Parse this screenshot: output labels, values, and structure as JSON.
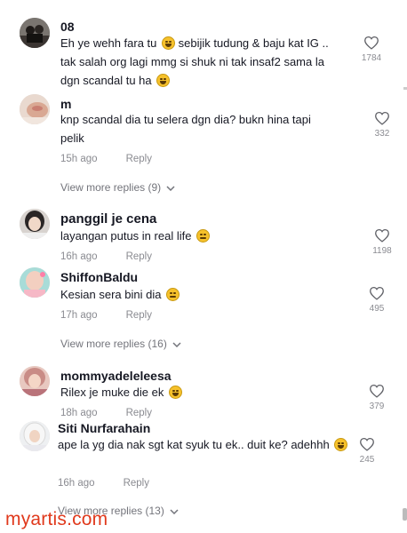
{
  "comments": [
    {
      "username": "08",
      "text": "Eh ye wehh fara tu",
      "text_after_emoji": "sebijik tudung & baju kat IG .. tak salah org lagi mmg si shuk ni tak insaf2 sama la dgn scandal tu ha",
      "likes": "1784"
    },
    {
      "username": "m",
      "text": "knp scandal dia tu selera dgn dia? bukn hina tapi pelik",
      "time": "15h ago",
      "reply_label": "Reply",
      "likes": "332",
      "view_more": "View more replies (9)"
    },
    {
      "username": "panggil je cena",
      "text": "layangan putus in real life",
      "time": "16h ago",
      "reply_label": "Reply",
      "likes": "1198"
    },
    {
      "username": "ShiffonBaldu",
      "text": "Kesian sera bini dia",
      "time": "17h ago",
      "reply_label": "Reply",
      "likes": "495",
      "view_more": "View more replies (16)"
    },
    {
      "username": "mommyadeleleesa",
      "text": "Rilex je muke die ek",
      "time": "18h ago",
      "reply_label": "Reply",
      "likes": "379"
    },
    {
      "username": "Siti Nurfarahain",
      "text": "ape la yg dia nak sgt kat syuk tu ek.. duit ke? adehhh",
      "time": "16h ago",
      "reply_label": "Reply",
      "likes": "245",
      "view_more": "View more replies (13)"
    }
  ],
  "watermark": "myartis.com",
  "colors": {
    "text": "#161823",
    "muted": "#8a8b91",
    "watermark": "#e0391c"
  }
}
